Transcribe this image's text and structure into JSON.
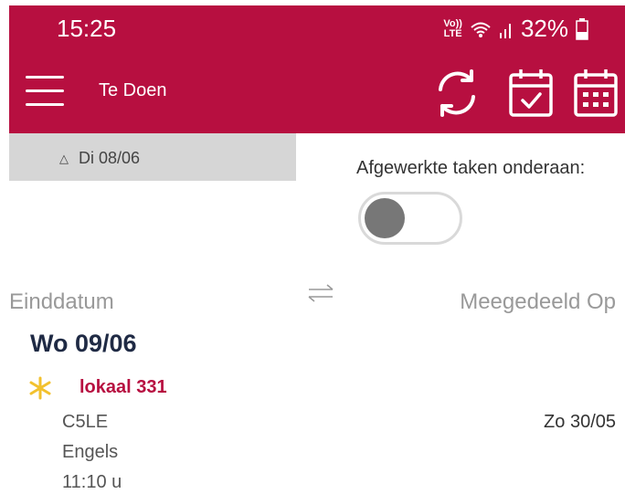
{
  "status_bar": {
    "time": "15:25",
    "volte_top": "Vo))",
    "volte_bottom": "LTE",
    "battery": "32%"
  },
  "app_bar": {
    "title": "Te Doen",
    "icons": [
      "menu-icon",
      "sync-icon",
      "calendar-check-icon",
      "calendar-grid-icon"
    ]
  },
  "date_tab": {
    "caret": "△",
    "label": "Di 08/06"
  },
  "filter": {
    "label": "Afgewerkte taken onderaan:",
    "toggle_on": false
  },
  "sort": {
    "left_label": "Einddatum",
    "right_label": "Meegedeeld Op"
  },
  "group": {
    "date": "Wo 09/06"
  },
  "task": {
    "title": "lokaal 331",
    "class": "C5LE",
    "subject": "Engels",
    "time": "11:10 u",
    "shared_on": "Zo 30/05"
  },
  "colors": {
    "brand": "#b70f40",
    "star": "#f2c12e",
    "heading": "#1f2a44"
  }
}
